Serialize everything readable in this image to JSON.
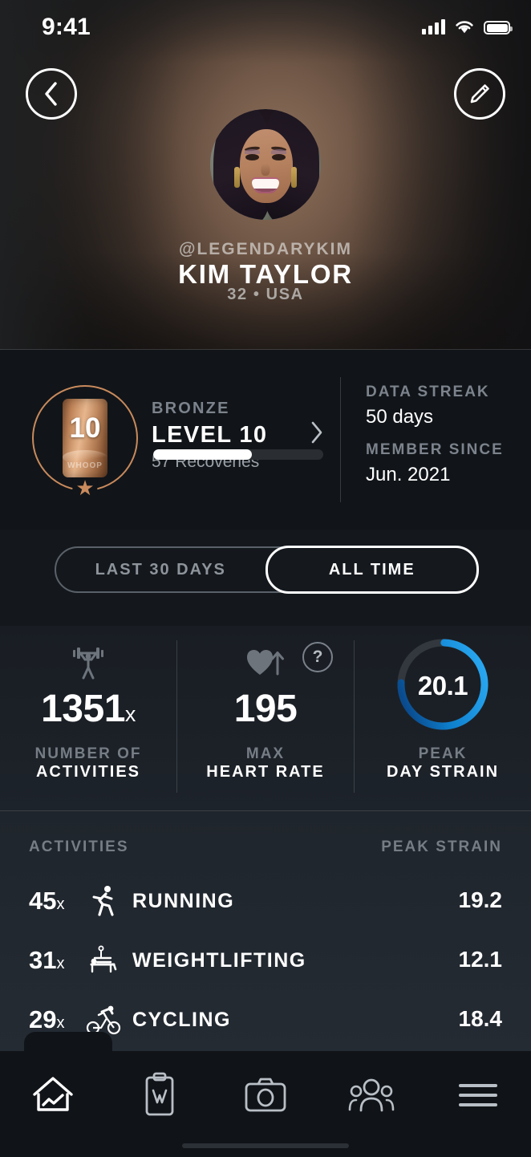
{
  "status_bar": {
    "time": "9:41",
    "cellular_icon": "cellular-signal-icon",
    "wifi_icon": "wifi-icon",
    "battery_icon": "battery-full-icon"
  },
  "header": {
    "back_label": "back-chevron",
    "edit_label": "edit-pencil"
  },
  "profile": {
    "handle": "@LEGENDARYKIM",
    "name": "KIM TAYLOR",
    "subinfo": "32 • USA",
    "avatar_alt": "profile-photo"
  },
  "level": {
    "tier": "BRONZE",
    "level": "LEVEL 10",
    "recoveries": "57 Recoveries",
    "badge_number": "10",
    "badge_brand": "WHOOP",
    "progress_percent": 58,
    "accent_color": "#c98a5c",
    "data_streak_label": "DATA STREAK",
    "data_streak_value": "50 days",
    "member_since_label": "MEMBER SINCE",
    "member_since_value": "Jun. 2021"
  },
  "toggle": {
    "options": [
      "LAST 30 DAYS",
      "ALL TIME"
    ],
    "selected": "ALL TIME"
  },
  "stats": [
    {
      "icon": "weightlifting-icon",
      "value": "1351",
      "suffix": "x",
      "label_line1": "NUMBER OF",
      "label_line2": "ACTIVITIES"
    },
    {
      "icon": "heart-rate-up-icon",
      "value": "195",
      "suffix": "",
      "label_line1": "MAX",
      "label_line2": "HEART RATE"
    },
    {
      "icon": "strain-ring",
      "value": "20.1",
      "suffix": "",
      "label_line1": "PEAK",
      "label_line2": "DAY STRAIN"
    }
  ],
  "help_icon": "?",
  "strain_ring": {
    "value": "20.1",
    "percent": 75,
    "color_start": "#0a4a8c",
    "color_end": "#2aa8f2",
    "track_color": "#33383f"
  },
  "activities_table": {
    "header_left": "ACTIVITIES",
    "header_right": "PEAK STRAIN",
    "rows": [
      {
        "count": "45",
        "count_suffix": "x",
        "icon": "running-icon",
        "name": "RUNNING",
        "peak_strain": "19.2"
      },
      {
        "count": "31",
        "count_suffix": "x",
        "icon": "weightlifting-bench-icon",
        "name": "WEIGHTLIFTING",
        "peak_strain": "12.1"
      },
      {
        "count": "29",
        "count_suffix": "x",
        "icon": "cycling-icon",
        "name": "CYCLING",
        "peak_strain": "18.4"
      }
    ]
  },
  "nav": {
    "items": [
      {
        "icon": "home-icon",
        "active": true
      },
      {
        "icon": "journal-clipboard-icon",
        "active": false
      },
      {
        "icon": "camera-icon",
        "active": false
      },
      {
        "icon": "community-people-icon",
        "active": false
      },
      {
        "icon": "menu-hamburger-icon",
        "active": false
      }
    ]
  }
}
